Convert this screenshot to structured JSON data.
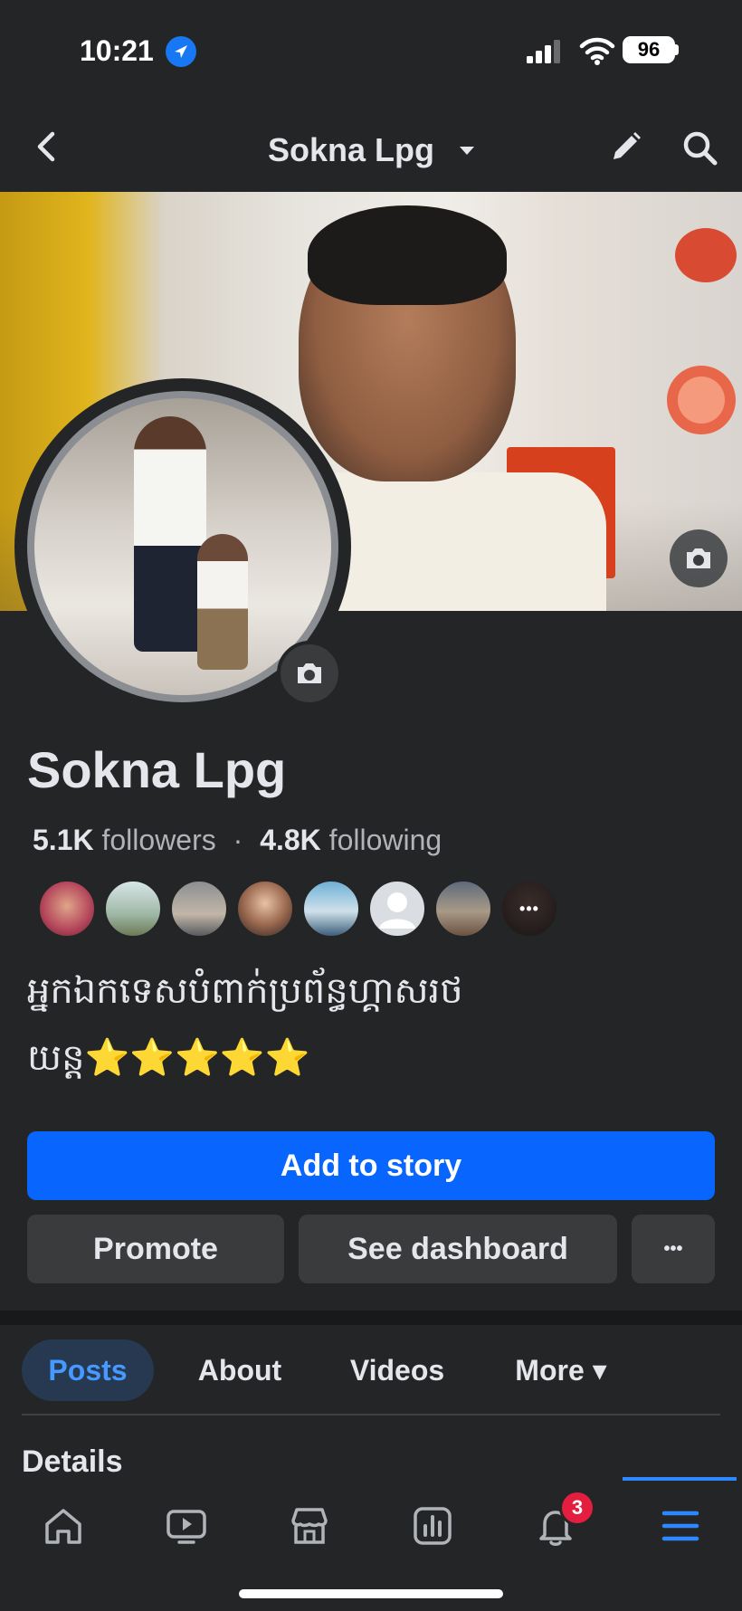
{
  "status_bar": {
    "time": "10:21",
    "battery": "96"
  },
  "header": {
    "title": "Sokna Lpg"
  },
  "profile": {
    "name": "Sokna Lpg",
    "followers_count": "5.1K",
    "followers_label": "followers",
    "separator": "·",
    "following_count": "4.8K",
    "following_label": "following",
    "bio_line1": "អ្នកឯកទេសបំពាក់ប្រព័ន្ធហ្គាសរថ",
    "bio_line2": "យន្ត⭐⭐⭐⭐⭐",
    "more_friends": "•••"
  },
  "actions": {
    "add_to_story": "Add to story",
    "promote": "Promote",
    "see_dashboard": "See dashboard",
    "more": "•••"
  },
  "tabs": [
    {
      "label": "Posts",
      "active": true
    },
    {
      "label": "About"
    },
    {
      "label": "Videos"
    },
    {
      "label": "More ▾"
    }
  ],
  "section": {
    "details": "Details"
  },
  "bottom_nav": {
    "items": [
      "home-icon",
      "video-icon",
      "marketplace-icon",
      "dashboard-icon",
      "notifications-icon",
      "menu-icon"
    ],
    "notifications_badge": "3",
    "accent": "#2d88ff"
  },
  "colors": {
    "primary_button": "#0866ff",
    "background": "#242526",
    "badge": "#e41e3f"
  }
}
